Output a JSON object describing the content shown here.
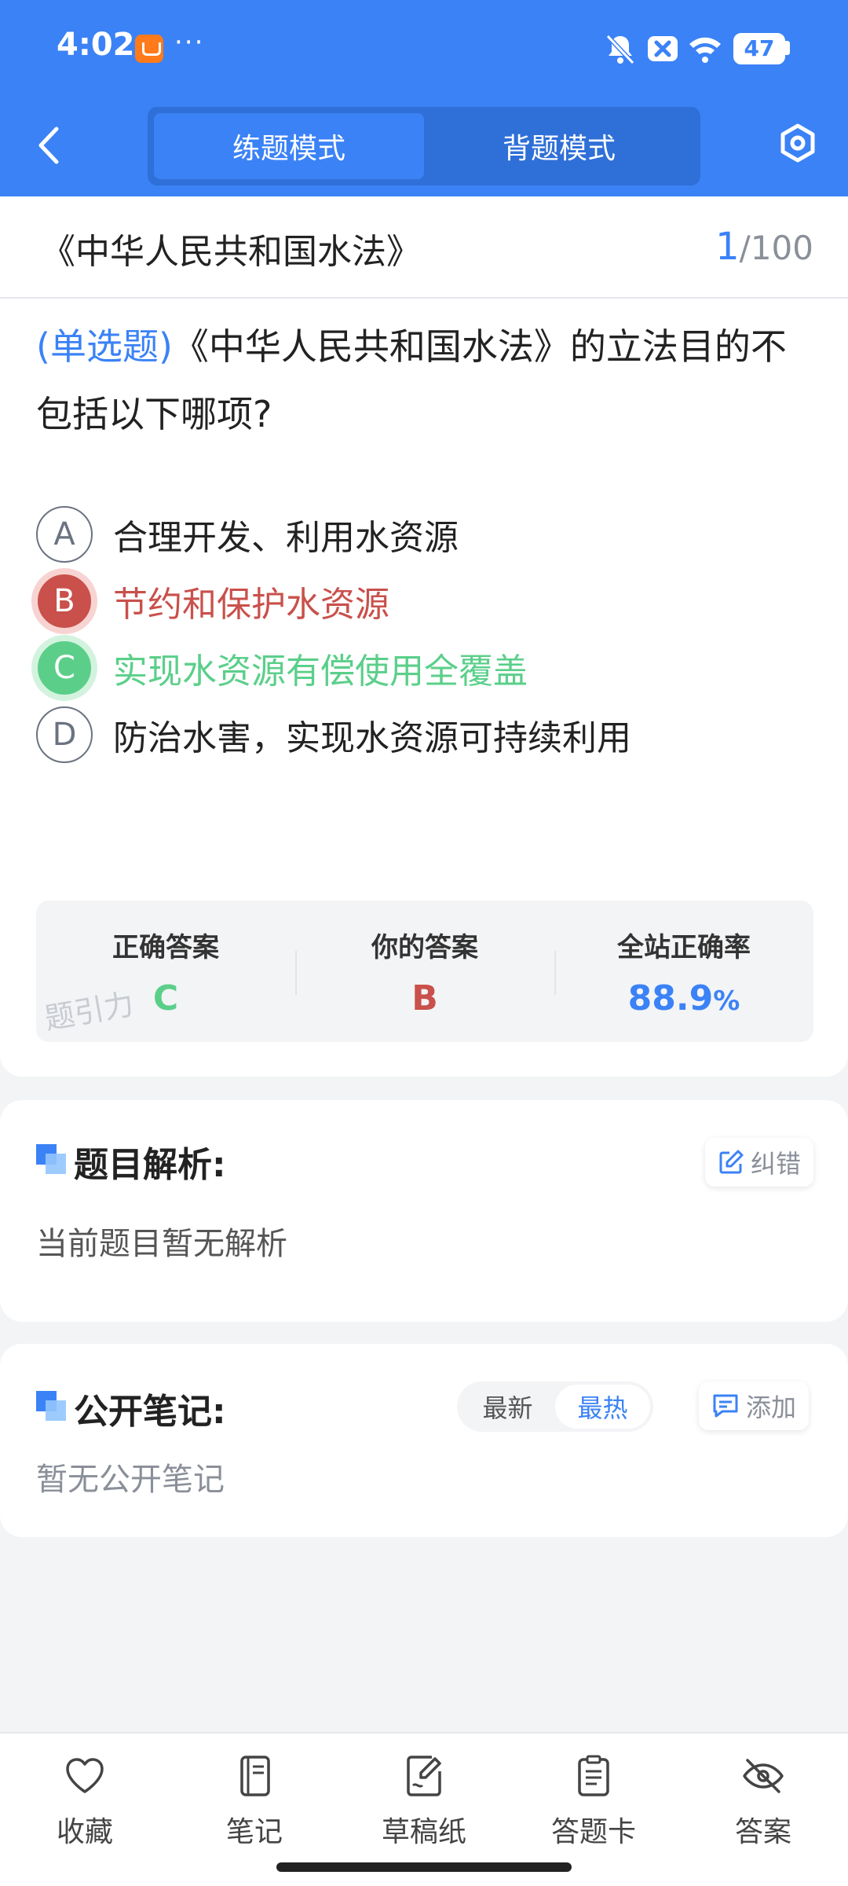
{
  "status_bar": {
    "time": "4:02",
    "dots": "···",
    "battery": "47",
    "icons": [
      "app-icon",
      "bell-muted-icon",
      "close-box-icon",
      "wifi-icon",
      "battery-icon"
    ]
  },
  "header": {
    "tabs": [
      {
        "label": "练题模式",
        "active": true
      },
      {
        "label": "背题模式",
        "active": false
      }
    ],
    "colors": {
      "primary": "#3b82f6"
    }
  },
  "question_header": {
    "paper_title": "《中华人民共和国水法》",
    "current": "1",
    "total": "/100"
  },
  "question": {
    "type_label": "(单选题)",
    "text": "《中华人民共和国水法》的立法目的不包括以下哪项?",
    "options": [
      {
        "letter": "A",
        "text": "合理开发、利用水资源",
        "state": "normal"
      },
      {
        "letter": "B",
        "text": "节约和保护水资源",
        "state": "wrong"
      },
      {
        "letter": "C",
        "text": "实现水资源有偿使用全覆盖",
        "state": "correct"
      },
      {
        "letter": "D",
        "text": "防治水害，实现水资源可持续利用",
        "state": "normal"
      }
    ]
  },
  "stats": {
    "correct_label": "正确答案",
    "correct_value": "C",
    "yours_label": "你的答案",
    "yours_value": "B",
    "rate_label": "全站正确率",
    "rate_value": "88.9",
    "rate_unit": "%",
    "watermark": "题引力"
  },
  "analysis": {
    "title": "题目解析:",
    "correct_btn": "纠错",
    "body": "当前题目暂无解析"
  },
  "notes": {
    "title": "公开笔记:",
    "sort_options": [
      {
        "label": "最新",
        "active": false
      },
      {
        "label": "最热",
        "active": true
      }
    ],
    "add_btn": "添加",
    "body": "暂无公开笔记"
  },
  "bottom_nav": {
    "items": [
      {
        "label": "收藏",
        "icon": "heart-icon"
      },
      {
        "label": "笔记",
        "icon": "notebook-icon"
      },
      {
        "label": "草稿纸",
        "icon": "draft-paper-icon"
      },
      {
        "label": "答题卡",
        "icon": "answer-card-icon"
      },
      {
        "label": "答案",
        "icon": "eye-off-icon"
      }
    ]
  }
}
